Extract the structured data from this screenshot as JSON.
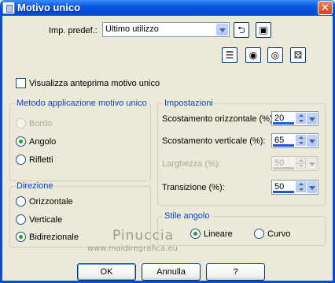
{
  "window": {
    "title": "Motivo unico",
    "close_glyph": "✕"
  },
  "preset": {
    "label": "Imp. predef.:",
    "value": "Ultimo utilizzo"
  },
  "preview_checkbox": {
    "label": "Visualizza anteprima motivo unico",
    "checked": false
  },
  "method_group": {
    "title": "Metodo applicazione motivo unico",
    "options": [
      {
        "label": "Bordo",
        "checked": false,
        "enabled": false
      },
      {
        "label": "Angolo",
        "checked": true,
        "enabled": true
      },
      {
        "label": "Rifletti",
        "checked": false,
        "enabled": true
      }
    ]
  },
  "direction_group": {
    "title": "Direzione",
    "options": [
      {
        "label": "Orizzontale",
        "checked": false
      },
      {
        "label": "Verticale",
        "checked": false
      },
      {
        "label": "Bidirezionale",
        "checked": true
      }
    ]
  },
  "settings_group": {
    "title": "Impostazioni",
    "fields": [
      {
        "label": "Scostamento orizzontale (%):",
        "value": "20",
        "enabled": true
      },
      {
        "label": "Scostamento verticale (%):",
        "value": "65",
        "enabled": true
      },
      {
        "label": "Larghezza (%):",
        "value": "50",
        "enabled": false
      },
      {
        "label": "Transizione (%):",
        "value": "50",
        "enabled": true
      }
    ]
  },
  "corner_style_group": {
    "title": "Stile angolo",
    "options": [
      {
        "label": "Lineare",
        "checked": true
      },
      {
        "label": "Curvo",
        "checked": false
      }
    ]
  },
  "watermark": {
    "line1": "Pinuccia",
    "line2": "www.maidiregrafica.eu"
  },
  "buttons": {
    "ok": "OK",
    "cancel": "Annulla",
    "help": "?"
  },
  "icons": [
    "reset-arrow-icon",
    "save-disk-icon",
    "list-icon",
    "lock-eye-icon",
    "eye-icon",
    "randomize-dice-icon"
  ]
}
